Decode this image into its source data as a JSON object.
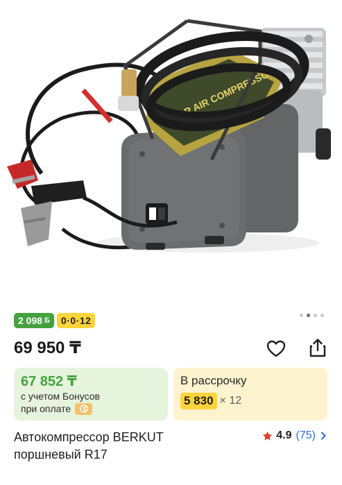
{
  "image": {
    "subject": "air-compressor-photo",
    "label_text": "CAR AIR COMPRESSOR"
  },
  "gallery": {
    "total_dots": 4,
    "active_index": 1
  },
  "badges": {
    "bonus": "2 098",
    "bonus_symbol": "Б",
    "installment": "0·0·12"
  },
  "price": {
    "value": "69 950 ₸"
  },
  "actions": {
    "favorite_icon": "heart-icon",
    "share_icon": "share-icon"
  },
  "bonus_card": {
    "amount": "67 852 ₸",
    "line1": "с учетом Бонусов",
    "line2": "при оплате"
  },
  "installment_card": {
    "title": "В рассрочку",
    "amount": "5 830",
    "term": "× 12"
  },
  "product": {
    "title": "Автокомпрессор BERKUT поршневый R17",
    "rating": "4.9",
    "reviews": "(75)"
  },
  "colors": {
    "bonus_green": "#44a23e",
    "installment_yellow": "#ffd43a",
    "link_blue": "#2c6fd6",
    "star_red": "#e53935"
  }
}
